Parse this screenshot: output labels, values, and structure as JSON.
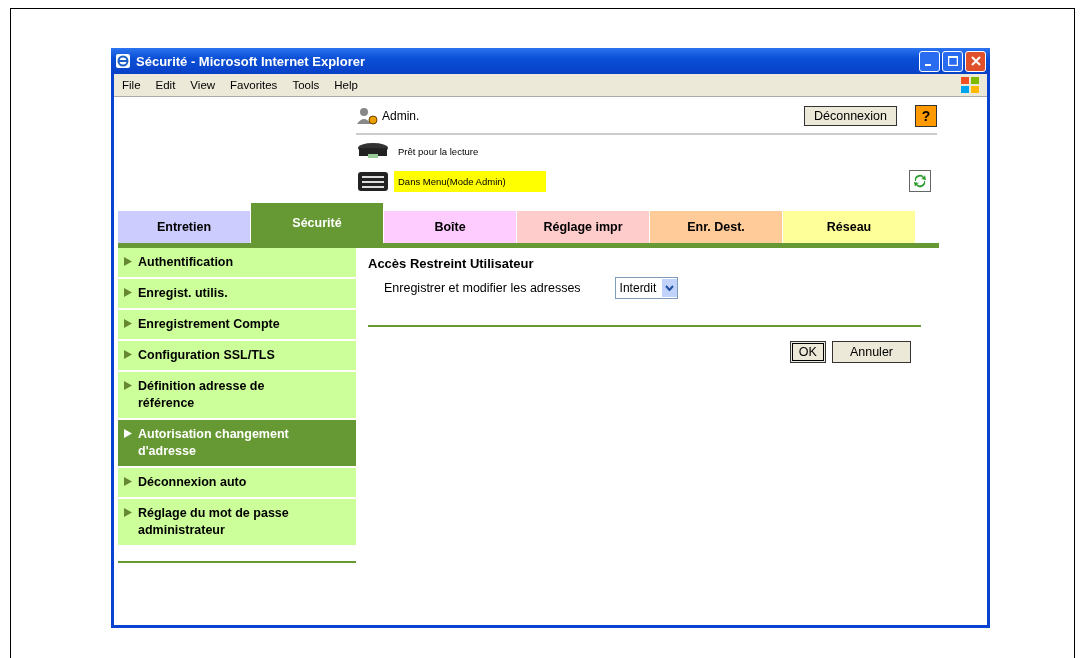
{
  "window": {
    "title": "Sécurité - Microsoft Internet Explorer"
  },
  "menu": [
    "File",
    "Edit",
    "View",
    "Favorites",
    "Tools",
    "Help"
  ],
  "header": {
    "user": "Admin.",
    "logout": "Déconnexion",
    "help": "?",
    "statuses": [
      {
        "kind": "ready",
        "text": "Prêt pour la lecture",
        "highlighted": false
      },
      {
        "kind": "menu",
        "text": "Dans Menu(Mode Admin)",
        "highlighted": true
      }
    ]
  },
  "tabs": [
    {
      "label": "Entretien",
      "selected": false,
      "color": "#ccccff"
    },
    {
      "label": "Sécurité",
      "selected": true,
      "color": "#669933"
    },
    {
      "label": "Boîte",
      "selected": false,
      "color": "#ffccff"
    },
    {
      "label": "Réglage impr",
      "selected": false,
      "color": "#ffcccc"
    },
    {
      "label": "Enr. Dest.",
      "selected": false,
      "color": "#ffcc99"
    },
    {
      "label": "Réseau",
      "selected": false,
      "color": "#ffff99"
    }
  ],
  "sidebar": {
    "items": [
      {
        "label": "Authentification",
        "selected": false
      },
      {
        "label": "Enregist. utilis.",
        "selected": false
      },
      {
        "label": "Enregistrement Compte",
        "selected": false
      },
      {
        "label": "Configuration SSL/TLS",
        "selected": false
      },
      {
        "label": "Définition adresse de référence",
        "selected": false
      },
      {
        "label": "Autorisation changement d'adresse",
        "selected": true
      },
      {
        "label": "Déconnexion auto",
        "selected": false
      },
      {
        "label": "Réglage du mot de passe administrateur",
        "selected": false
      }
    ]
  },
  "content": {
    "title": "Accès Restreint Utilisateur",
    "field_label": "Enregistrer et modifier les adresses",
    "select_value": "Interdit",
    "buttons": [
      "OK",
      "Annuler"
    ]
  }
}
